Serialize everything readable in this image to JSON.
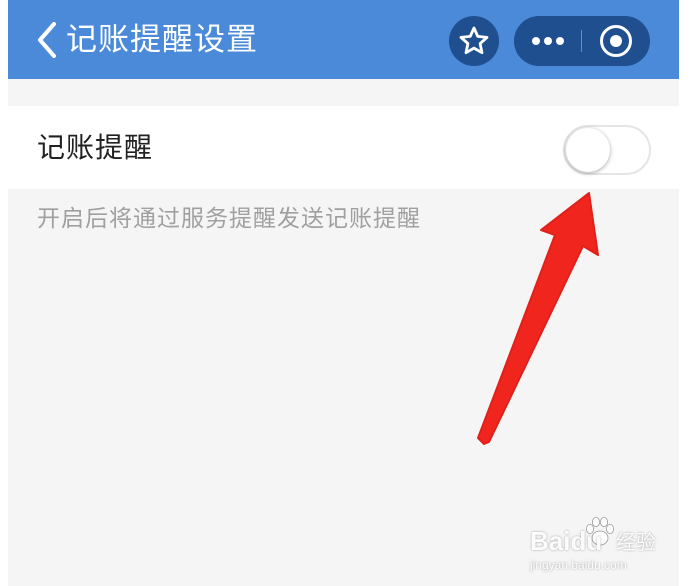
{
  "nav": {
    "title": "记账提醒设置",
    "back_icon": "chevron-left-icon",
    "favorite_icon": "star-outline-icon",
    "more_icon": "more-dots-icon",
    "close_icon": "target-circle-icon",
    "background_color": "#4a8ad9",
    "capsule_color": "#1f4f8e"
  },
  "setting": {
    "label": "记账提醒",
    "toggle_on": false,
    "description": "开启后将通过服务提醒发送记账提醒"
  },
  "annotation": {
    "type": "red-arrow",
    "color": "#f0261e",
    "points_to": "setting-toggle"
  },
  "watermark": {
    "brand": "Baidu",
    "label": "经验",
    "domain": "jingyan.baidu.com"
  }
}
